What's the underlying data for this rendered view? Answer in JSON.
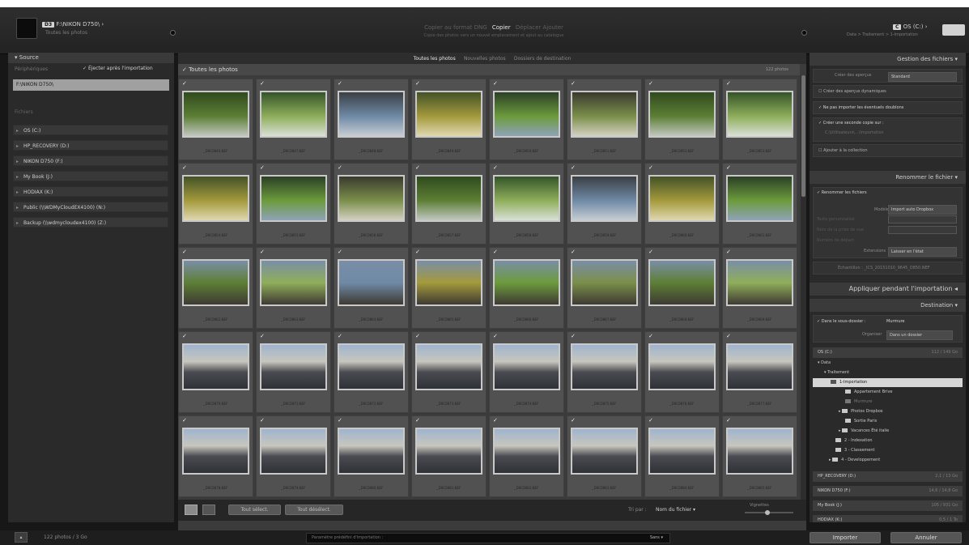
{
  "top": {
    "source_badge": "D3",
    "source_name": "F:\\NIKON D750\\",
    "source_sub": "Toutes les photos",
    "modes": [
      "Copier au format DNG",
      "Copier",
      "Déplacer",
      "Ajouter"
    ],
    "mode_hint": "Copie des photos vers un nouvel emplacement et ajout au catalogue",
    "dest_badge": "C",
    "dest_name": "OS (C:)",
    "dest_sub": "Data > Traitement > 1-Importation"
  },
  "left": {
    "source_label": "Source",
    "peripheriques_label": "Périphériques",
    "eject_label": "Éjecter après l'importation",
    "device": "F:\\NIKON D750\\",
    "files_label": "Fichiers",
    "volumes": [
      "OS (C:)",
      "HP_RECOVERY (D:)",
      "NIKON D750 (F:)",
      "My Book (J:)",
      "HODIAX (K:)",
      "Public (\\\\WDMyCloudEX4100) (N:)",
      "Backup (\\\\wdmycloudex4100) (Z:)"
    ]
  },
  "center": {
    "tabs": [
      "Toutes les photos",
      "Nouvelles photos",
      "Dossiers de destination"
    ],
    "select_all_label": "Toutes les photos",
    "count": "122 photos",
    "filenames": [
      "_DSC0846.NEF",
      "_DSC0847.NEF",
      "_DSC0848.NEF",
      "_DSC0849.NEF",
      "_DSC0850.NEF",
      "_DSC0851.NEF",
      "_DSC0852.NEF",
      "_DSC0853.NEF",
      "_DSC0854.NEF",
      "_DSC0855.NEF",
      "_DSC0856.NEF",
      "_DSC0857.NEF",
      "_DSC0858.NEF",
      "_DSC0859.NEF",
      "_DSC0860.NEF",
      "_DSC0861.NEF",
      "_DSC0862.NEF",
      "_DSC0863.NEF",
      "_DSC0864.NEF",
      "_DSC0865.NEF",
      "_DSC0866.NEF",
      "_DSC0867.NEF",
      "_DSC0868.NEF",
      "_DSC0869.NEF",
      "_DSC0870.NEF",
      "_DSC0871.NEF",
      "_DSC0872.NEF",
      "_DSC0873.NEF",
      "_DSC0874.NEF",
      "_DSC0875.NEF",
      "_DSC0876.NEF",
      "_DSC0877.NEF",
      "_DSC0878.NEF",
      "_DSC0879.NEF",
      "_DSC0880.NEF",
      "_DSC0881.NEF",
      "_DSC0882.NEF",
      "_DSC0883.NEF",
      "_DSC0884.NEF",
      "_DSC0885.NEF"
    ],
    "check_all_btn": "Tout sélect.",
    "uncheck_all_btn": "Tout désélect.",
    "sort_label": "Tri par :",
    "sort_value": "Nom du fichier",
    "thumb_label": "Vignettes"
  },
  "right": {
    "file_mgmt": "Gestion des fichiers",
    "create_previews_label": "Créer des aperçus",
    "create_previews_value": "Standard",
    "smart_previews": "Créer des aperçus dynamiques",
    "no_duplicates": "Ne pas importer les éventuels doublons",
    "second_copy": "Créer une seconde copie sur :",
    "second_copy_path": "C:\\Utilisateurs\\...\\Importation",
    "add_collection": "Ajouter à la collection",
    "rename_head": "Renommer le fichier",
    "rename_files": "Renommer les fichiers",
    "template_label": "Modèle",
    "template_value": "Import auto Dropbox",
    "custom_text_label": "Texte personnalisé",
    "shoot_name_label": "Nom de la prise de vue",
    "start_number_label": "Numéro de départ",
    "extensions_label": "Extensions",
    "extensions_value": "Laisser en l'état",
    "example": "Échantillon : _ICS_20151010_9645_D850.NEF",
    "apply_head": "Appliquer pendant l'importation",
    "dest_head": "Destination",
    "subfolder_label": "Dans le sous-dossier :",
    "subfolder_value": "Murmure",
    "organize_label": "Organiser",
    "organize_value": "Dans un dossier",
    "dest_vol": "OS (C:)",
    "dest_vol_size": "112 / 149 Go",
    "folders": [
      "Data",
      "Traitement",
      "1-Importation",
      "Appartement Brive",
      "Murmure",
      "Photos Dropbox",
      "Sortie Paris",
      "Vacances Été italie",
      "2 - Indexation",
      "3 - Classement",
      "4 - Developpement"
    ],
    "other_vols": [
      {
        "name": "HP_RECOVERY (D:)",
        "size": "2,1 / 13 Go"
      },
      {
        "name": "NIKON D750 (F:)",
        "size": "14,6 / 14,8 Go"
      },
      {
        "name": "My Book (J:)",
        "size": "105 / 931 Go"
      },
      {
        "name": "HODIAX (K:)",
        "size": "0,5 / 1 To"
      }
    ]
  },
  "bottom": {
    "status": "122 photos / 3 Go",
    "preset_label": "Paramètre prédéfini d'importation :",
    "preset_value": "Sans",
    "import_btn": "Importer",
    "cancel_btn": "Annuler"
  }
}
